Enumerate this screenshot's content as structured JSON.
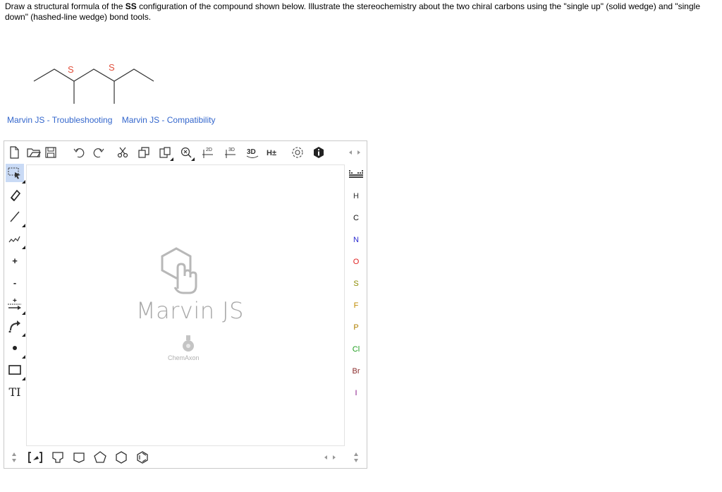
{
  "question": {
    "part1": "Draw a structural formula of the ",
    "bold": "SS",
    "part2": " configuration of the compound shown below. Illustrate the stereochemistry about the two chiral carbons using the \"single up\" (solid wedge) and \"single down\" (hashed-line wedge) bond tools."
  },
  "molecule": {
    "atom_labels": [
      "S",
      "S"
    ],
    "label_color": "#e0503c"
  },
  "links": [
    {
      "label": "Marvin JS - Troubleshooting"
    },
    {
      "label": "Marvin JS - Compatibility"
    }
  ],
  "editor": {
    "top_toolbar": {
      "icons": [
        "new-document-icon",
        "open-icon",
        "save-icon",
        "undo-icon",
        "redo-icon",
        "cut-icon",
        "copy-icon",
        "paste-icon",
        "zoom-icon",
        "clean-2d-icon",
        "clean-3d-icon",
        "3d-view-icon",
        "hydrogen-toggle-icon",
        "settings-icon",
        "info-icon",
        "scroll-arrows-icon"
      ],
      "clean2d_label": "2D",
      "clean3d_label": "3D",
      "view3d_label": "3D",
      "hydrogen_label": "H±"
    },
    "left_toolbar": {
      "icons": [
        "select-icon",
        "erase-icon",
        "single-bond-icon",
        "chain-icon",
        "increase-charge-icon",
        "decrease-charge-icon",
        "reaction-arrow-icon",
        "curved-arrow-icon",
        "radical-icon",
        "rectangle-icon",
        "text-icon"
      ],
      "plus_label": "+",
      "minus_label": "-",
      "text_label": "TI"
    },
    "watermark": {
      "title": "Marvin JS",
      "company": "ChemAxon"
    },
    "elements": [
      {
        "symbol": "H",
        "color": "#333333"
      },
      {
        "symbol": "C",
        "color": "#111111"
      },
      {
        "symbol": "N",
        "color": "#2a2ad0"
      },
      {
        "symbol": "O",
        "color": "#e02020"
      },
      {
        "symbol": "S",
        "color": "#8b8b00"
      },
      {
        "symbol": "F",
        "color": "#c08a00"
      },
      {
        "symbol": "P",
        "color": "#b08000"
      },
      {
        "symbol": "Cl",
        "color": "#1e9e1e"
      },
      {
        "symbol": "Br",
        "color": "#8a2a2a"
      },
      {
        "symbol": "I",
        "color": "#8a1a8a"
      }
    ],
    "bottom_toolbar": {
      "icons": [
        "scroll-up-down-icon",
        "bracket-icon",
        "cyclopropane-icon",
        "cyclobutane-icon",
        "cyclopentane-icon",
        "cyclohexane-icon",
        "benzene-icon",
        "scroll-arrows-icon",
        "scroll-up-down-icon"
      ]
    }
  }
}
